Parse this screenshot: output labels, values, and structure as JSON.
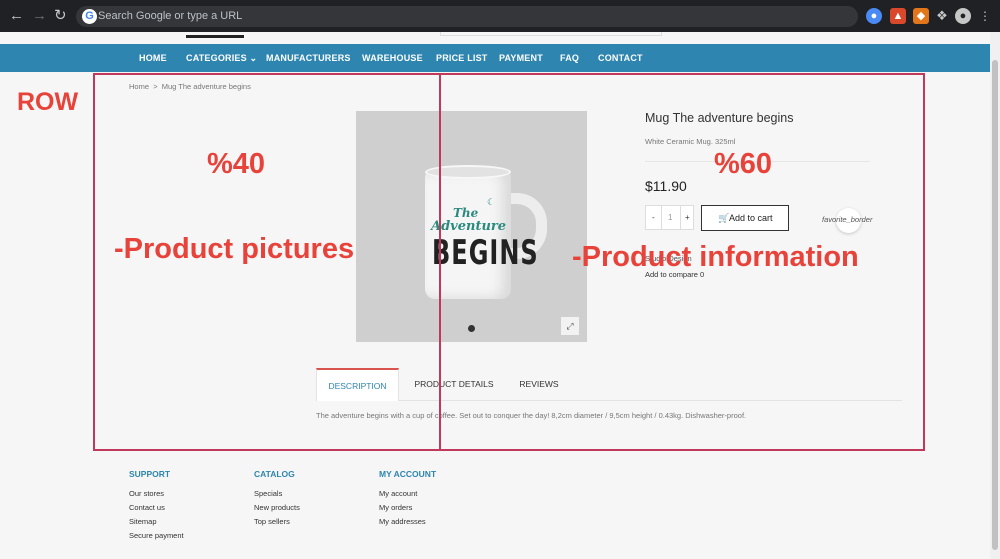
{
  "browser": {
    "omnibox_placeholder": "Search Google or type a URL",
    "back_icon": "arrow-left-icon",
    "forward_icon": "arrow-right-icon",
    "reload_icon": "reload-icon",
    "extensions": [
      "translate-icon",
      "extension-fire-icon",
      "metamask-icon",
      "puzzle-icon",
      "profile-icon",
      "kebab-menu-icon"
    ]
  },
  "nav": {
    "items": [
      "HOME",
      "CATEGORIES",
      "MANUFACTURERS",
      "WAREHOUSE",
      "PRICE LIST",
      "PAYMENT",
      "FAQ",
      "CONTACT"
    ],
    "accent": "#2e86b0"
  },
  "breadcrumb": {
    "home": "Home",
    "sep": ">",
    "current": "Mug The adventure begins"
  },
  "product": {
    "title": "Mug The adventure begins",
    "short_desc": "White Ceramic Mug. 325ml",
    "price": "$11.90",
    "qty_minus": "-",
    "qty_value": "1",
    "qty_plus": "+",
    "add_to_cart": "Add to cart",
    "favorite": "favorite_border",
    "brand": "Studio Design",
    "compare": "Add to compare 0",
    "mug_line1": "The",
    "mug_line2": "Adventure",
    "mug_line3": "BEGINS"
  },
  "tabs": {
    "items": [
      "DESCRIPTION",
      "PRODUCT DETAILS",
      "REVIEWS"
    ],
    "content": "The adventure begins with a cup of coffee. Set out to conquer the day! 8,2cm diameter / 9,5cm height / 0.43kg. Dishwasher-proof."
  },
  "footer": {
    "support": {
      "title": "SUPPORT",
      "links": [
        "Our stores",
        "Contact us",
        "Sitemap",
        "Secure payment"
      ]
    },
    "catalog": {
      "title": "CATALOG",
      "links": [
        "Specials",
        "New products",
        "Top sellers"
      ]
    },
    "account": {
      "title": "MY ACCOUNT",
      "links": [
        "My account",
        "My orders",
        "My addresses"
      ]
    }
  },
  "annotations": {
    "row": "ROW",
    "left_pct": "%40",
    "right_pct": "%60",
    "left_label": "-Product pictures",
    "right_label": "-Product information",
    "color": "#c0395a",
    "text_color": "#e8433b"
  }
}
